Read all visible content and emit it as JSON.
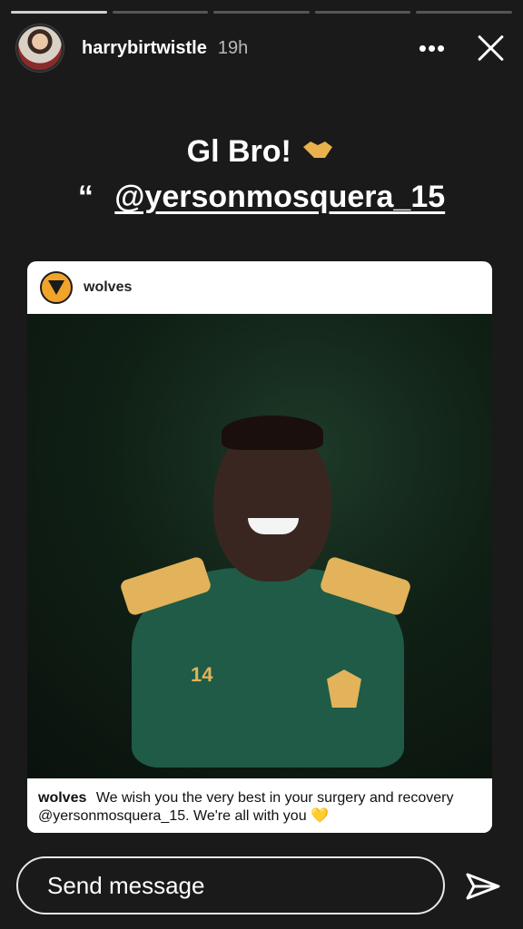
{
  "header": {
    "username": "harrybirtwistle",
    "time": "19h",
    "more_label": "•••"
  },
  "text": {
    "line1": "Gl Bro!",
    "quote_mark": "“",
    "mention": "@yersonmosquera_15"
  },
  "card": {
    "account": "wolves",
    "caption_account": "wolves",
    "caption_text": "We wish you the very best in your surgery and recovery @yersonmosquera_15. We're all with you",
    "heart": "💛",
    "jersey_number": "14"
  },
  "footer": {
    "send_placeholder": "Send message"
  },
  "progress": {
    "segments_total": 5,
    "segments_done": 1
  }
}
